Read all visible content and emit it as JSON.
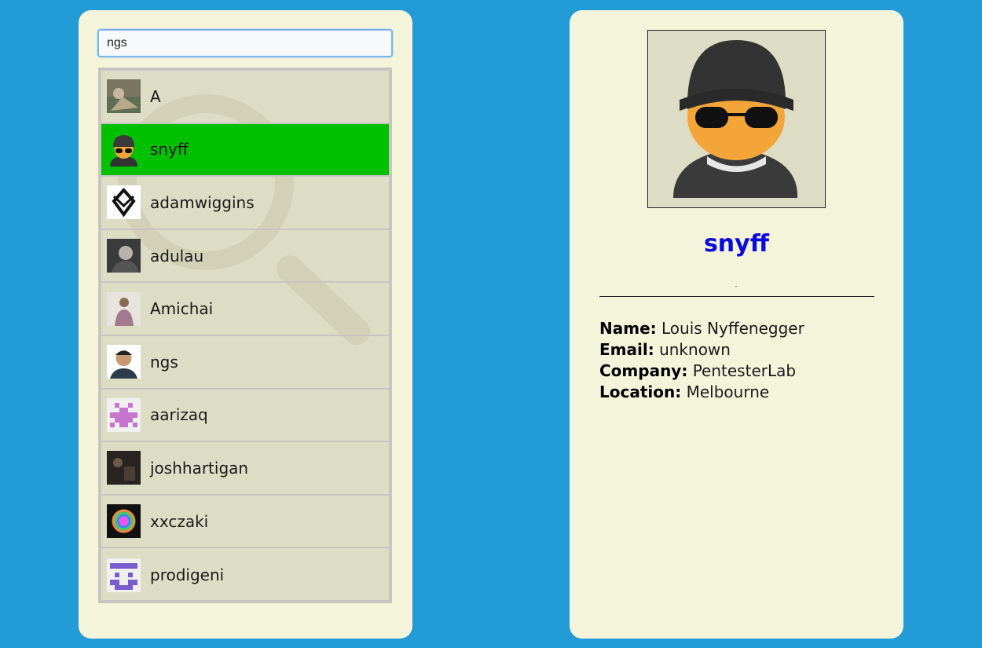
{
  "search": {
    "value": "ngs",
    "placeholder": ""
  },
  "results": [
    {
      "label": "A",
      "avatar": "painting-avatar",
      "selected": false
    },
    {
      "label": "snyff",
      "avatar": "beanie-sunglasses-avatar",
      "selected": true
    },
    {
      "label": "adamwiggins",
      "avatar": "diamond-logo-avatar",
      "selected": false
    },
    {
      "label": "adulau",
      "avatar": "photo-man-avatar",
      "selected": false
    },
    {
      "label": "Amichai",
      "avatar": "photo-person-avatar",
      "selected": false
    },
    {
      "label": "ngs",
      "avatar": "photo-portrait-avatar",
      "selected": false
    },
    {
      "label": "aarizaq",
      "avatar": "pink-identicon-avatar",
      "selected": false
    },
    {
      "label": "joshhartigan",
      "avatar": "dark-photo-avatar",
      "selected": false
    },
    {
      "label": "xxczaki",
      "avatar": "rainbow-helmet-avatar",
      "selected": false
    },
    {
      "label": "prodigeni",
      "avatar": "purple-identicon-avatar",
      "selected": false
    }
  ],
  "profile": {
    "name": "snyff",
    "fields": [
      {
        "label": "Name:",
        "value": "Louis Nyffenegger"
      },
      {
        "label": "Email:",
        "value": "unknown"
      },
      {
        "label": "Company:",
        "value": "PentesterLab"
      },
      {
        "label": "Location:",
        "value": "Melbourne"
      }
    ]
  },
  "colors": {
    "background": "#229bd6",
    "panel": "#f4f4db",
    "list_bg": "#dddcc4",
    "selected_row": "#00c000",
    "profile_name": "#0a0add"
  }
}
